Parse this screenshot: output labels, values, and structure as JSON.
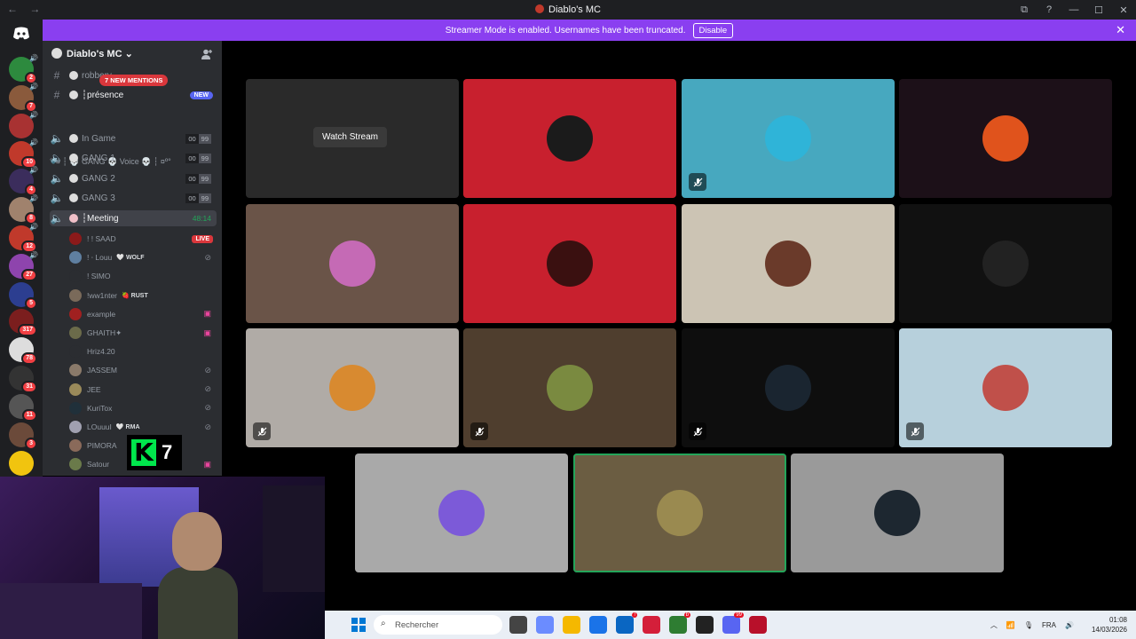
{
  "window": {
    "title": "Diablo's MC",
    "nav_back": "←",
    "nav_forward": "→",
    "controls": [
      "⧉",
      "?",
      "—",
      "☐",
      "✕"
    ]
  },
  "banner": {
    "text": "Streamer Mode is enabled. Usernames have been truncated.",
    "button": "Disable",
    "close": "✕"
  },
  "servers": {
    "items": [
      {
        "badge": "2",
        "color": "#2d8a3e"
      },
      {
        "badge": "7",
        "color": "#8a5a3c"
      },
      {
        "badge": "",
        "color": "#a83232"
      },
      {
        "badge": "10",
        "color": "#c0392b"
      },
      {
        "badge": "4",
        "color": "#3b2d5c"
      },
      {
        "badge": "8",
        "color": "#a0826d"
      },
      {
        "badge": "12",
        "color": "#c0392b"
      },
      {
        "badge": "27",
        "color": "#8e44ad"
      },
      {
        "badge": "5",
        "color": "#2c3e90"
      },
      {
        "badge": "317",
        "color": "#7b1e1e"
      },
      {
        "badge": "78",
        "color": "#dddddd"
      },
      {
        "badge": "31",
        "color": "#333333"
      },
      {
        "badge": "11",
        "color": "#555555"
      },
      {
        "badge": "3",
        "color": "#6b4a3a"
      },
      {
        "badge": "",
        "color": "#f1c40f"
      }
    ]
  },
  "sidebar": {
    "server_name": "Diablo's MC",
    "chevron": "⌄",
    "mentions": "7 NEW MENTIONS",
    "channels": [
      {
        "name": "robbery",
        "type": "text"
      },
      {
        "name": "┆présence",
        "type": "text",
        "badge": "NEW"
      }
    ],
    "category": "°º¤ ┆ 💀 GANG 💀 Voice 💀 ┆ ¤º°",
    "voice": [
      {
        "name": "In Game",
        "lim_a": "00",
        "lim_b": "99"
      },
      {
        "name": "GANG 1",
        "lim_a": "00",
        "lim_b": "99"
      },
      {
        "name": "GANG 2",
        "lim_a": "00",
        "lim_b": "99"
      },
      {
        "name": "GANG 3",
        "lim_a": "00",
        "lim_b": "99"
      },
      {
        "name": "┆Meeting",
        "timer": "48:14"
      }
    ],
    "users": [
      {
        "name": "! ! SAAD",
        "tag": "",
        "status": "LIVE",
        "color": "#8b1a1a"
      },
      {
        "name": "! ⸱ Louu",
        "tag": "🤍 WOLF",
        "status": "⊘",
        "color": "#5f7fa0"
      },
      {
        "name": "! SIMO",
        "tag": "",
        "status": "",
        "color": "#2b2d31"
      },
      {
        "name": "!ww1nter",
        "tag": "🍓 RUST",
        "status": "",
        "color": "#7a6a5a"
      },
      {
        "name": "example",
        "tag": "",
        "status": "▣",
        "color": "#a02020"
      },
      {
        "name": "GHAITH✦",
        "tag": "",
        "status": "▣",
        "color": "#6b6b4a"
      },
      {
        "name": "Hriz4.20",
        "tag": "",
        "status": "",
        "color": "#2b2d31"
      },
      {
        "name": "JASSEM",
        "tag": "",
        "status": "⊘",
        "color": "#8a7a6a"
      },
      {
        "name": "JEE",
        "tag": "",
        "status": "⊘",
        "color": "#9a8a5a"
      },
      {
        "name": "KuriTox",
        "tag": "",
        "status": "⊘",
        "color": "#20303a"
      },
      {
        "name": "LOuuuI",
        "tag": "🤍 RMA",
        "status": "⊘",
        "color": "#a0a0b0"
      },
      {
        "name": "PIMORA",
        "tag": "",
        "status": "",
        "color": "#8a6a5a"
      },
      {
        "name": "Satour",
        "tag": "",
        "status": "▣",
        "color": "#6a7a4a"
      }
    ]
  },
  "stage": {
    "watch_stream": "Watch Stream",
    "mute_icon": "🎙",
    "tiles": [
      {
        "bg": "#2a2a2a",
        "pic": "",
        "muted": false,
        "stream": true
      },
      {
        "bg": "#c8202e",
        "pic": "#1b1b1b",
        "muted": false
      },
      {
        "bg": "#47a8bf",
        "pic": "#2fb4d8",
        "muted": true
      },
      {
        "bg": "#1c1018",
        "pic": "#e0531c",
        "muted": false
      },
      {
        "bg": "#6a5448",
        "pic": "#c56ab5",
        "muted": false
      },
      {
        "bg": "#c8202e",
        "pic": "#3a1010",
        "muted": false
      },
      {
        "bg": "#ccc4b4",
        "pic": "#6a3a2a",
        "muted": false
      },
      {
        "bg": "#111111",
        "pic": "#222222",
        "muted": false
      },
      {
        "bg": "#b0aba6",
        "pic": "#d88a30",
        "muted": true
      },
      {
        "bg": "#4f3e2e",
        "pic": "#7a8a40",
        "muted": true
      },
      {
        "bg": "#0e0e0e",
        "pic": "#1a2530",
        "muted": true
      },
      {
        "bg": "#b7d0dc",
        "pic": "#c0504a",
        "muted": true
      },
      {
        "bg": "#a9a9a9",
        "pic": "#7c5ad8",
        "muted": false
      },
      {
        "bg": "#6b5d42",
        "pic": "#9a8a50",
        "muted": false,
        "speaking": true
      },
      {
        "bg": "#9a9a9a",
        "pic": "#1d2730",
        "muted": false
      }
    ]
  },
  "logo": {
    "letter": "K",
    "number": "7"
  },
  "taskbar": {
    "search_placeholder": "Rechercher",
    "search_icon": "⌕",
    "apps": [
      {
        "color": "#444444",
        "badge": ""
      },
      {
        "color": "#6b8cff",
        "badge": ""
      },
      {
        "color": "#f5b800",
        "badge": ""
      },
      {
        "color": "#1a73e8",
        "badge": ""
      },
      {
        "color": "#0a66c2",
        "badge": "!"
      },
      {
        "color": "#d41f3a",
        "badge": ""
      },
      {
        "color": "#2e7d32",
        "badge": "b"
      },
      {
        "color": "#222222",
        "badge": ""
      },
      {
        "color": "#5865f2",
        "badge": "99"
      },
      {
        "color": "#b8102a",
        "badge": ""
      }
    ],
    "tray_arrow": "︿",
    "tray_lang": "FRA",
    "time": "01:08",
    "date": "14/03/2026"
  }
}
